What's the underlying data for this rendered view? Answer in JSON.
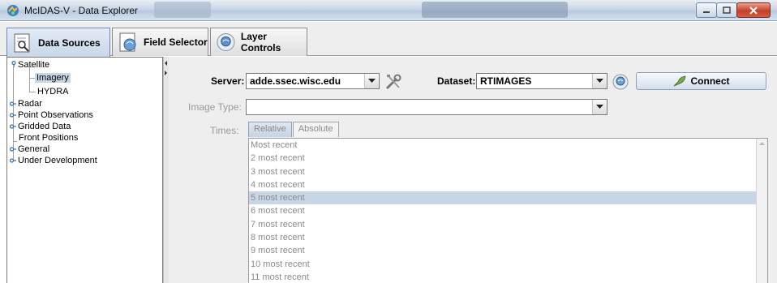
{
  "window": {
    "title": "McIDAS-V - Data Explorer"
  },
  "tabs": [
    {
      "label": "Data Sources",
      "icon": "data-sources-icon",
      "selected": true
    },
    {
      "label": "Field Selector",
      "icon": "field-selector-icon",
      "selected": false
    },
    {
      "label": "Layer Controls",
      "icon": "layer-controls-icon",
      "selected": false
    }
  ],
  "tree": {
    "satellite": "Satellite",
    "imagery": "Imagery",
    "hydra": "HYDRA",
    "radar": "Radar",
    "point_observations": "Point Observations",
    "gridded_data": "Gridded Data",
    "front_positions": "Front Positions",
    "general": "General",
    "under_development": "Under Development"
  },
  "form": {
    "server_label": "Server:",
    "server_value": "adde.ssec.wisc.edu",
    "dataset_label": "Dataset:",
    "dataset_value": "RTIMAGES",
    "connect_label": "Connect",
    "image_type_label": "Image Type:",
    "image_type_value": "",
    "times_label": "Times:"
  },
  "time_tabs": {
    "relative": "Relative",
    "absolute": "Absolute",
    "selected": "Relative"
  },
  "times": [
    "Most recent",
    "2 most recent",
    "3 most recent",
    "4 most recent",
    "5 most recent",
    "6 most recent",
    "7 most recent",
    "8 most recent",
    "9 most recent",
    "10 most recent",
    "11 most recent"
  ],
  "selected_time": "5 most recent",
  "colors": {
    "selection": "#c7d6e6",
    "tab_selected": "#c7d6ea",
    "disabled_text": "#9a9a9a"
  }
}
